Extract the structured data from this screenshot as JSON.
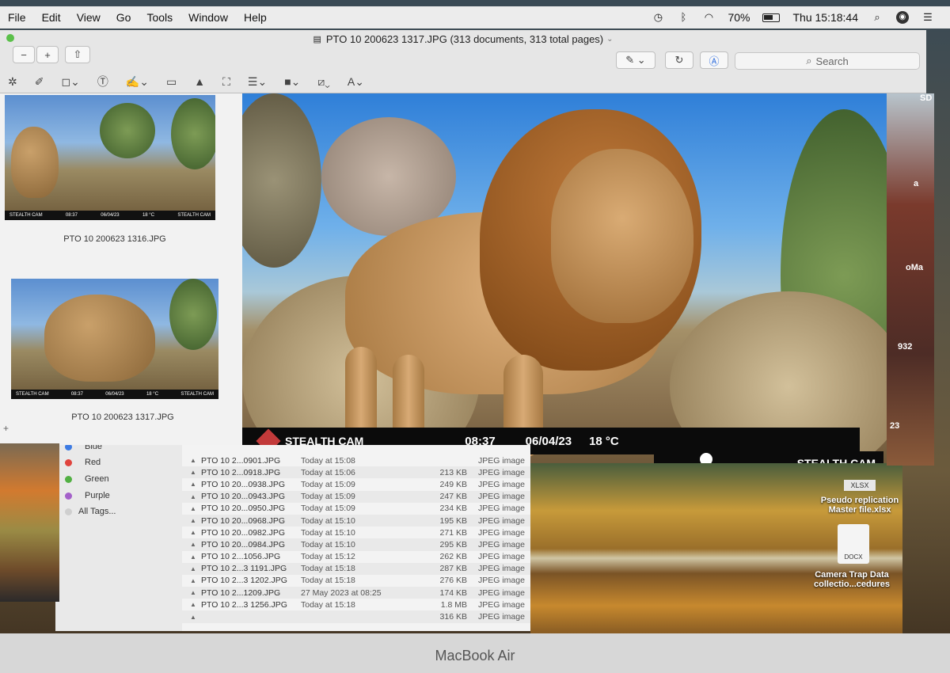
{
  "menubar": {
    "items": [
      "File",
      "Edit",
      "View",
      "Go",
      "Tools",
      "Window",
      "Help"
    ],
    "battery": "70%",
    "clock": "Thu 15:18:44"
  },
  "window": {
    "title": "PTO 10 200623 1317.JPG (313 documents, 313 total pages)",
    "search_placeholder": "Search"
  },
  "sidebar": {
    "thumbs": [
      {
        "caption": "PTO 10 200623 1316.JPG",
        "brand": "STEALTH CAM",
        "time": "08:37",
        "date": "06/04/23",
        "temp": "18 °C"
      },
      {
        "caption": "PTO 10 200623 1317.JPG",
        "brand": "STEALTH CAM",
        "time": "08:37",
        "date": "06/04/23",
        "temp": "18 °C"
      }
    ]
  },
  "photo": {
    "brand": "STEALTH CAM",
    "time": "08:37",
    "date": "06/04/23",
    "temp": "18 °C",
    "brand_right": "STEALTH CAM"
  },
  "finder": {
    "tags": [
      {
        "label": "Blue",
        "color": "#3d7be3"
      },
      {
        "label": "Red",
        "color": "#e0443e"
      },
      {
        "label": "Green",
        "color": "#52b043"
      },
      {
        "label": "Purple",
        "color": "#a461c9"
      },
      {
        "label": "All Tags...",
        "color": "#cfcfcf"
      }
    ],
    "rows": [
      {
        "name": "PTO 10 2...0901.JPG",
        "date": "Today at 15:08",
        "size": "",
        "kind": "JPEG image"
      },
      {
        "name": "PTO 10 2...0918.JPG",
        "date": "Today at 15:06",
        "size": "213 KB",
        "kind": "JPEG image"
      },
      {
        "name": "PTO 10 20...0938.JPG",
        "date": "Today at 15:09",
        "size": "249 KB",
        "kind": "JPEG image"
      },
      {
        "name": "PTO 10 20...0943.JPG",
        "date": "Today at 15:09",
        "size": "247 KB",
        "kind": "JPEG image"
      },
      {
        "name": "PTO 10 20...0950.JPG",
        "date": "Today at 15:09",
        "size": "234 KB",
        "kind": "JPEG image"
      },
      {
        "name": "PTO 10 20...0968.JPG",
        "date": "Today at 15:10",
        "size": "195 KB",
        "kind": "JPEG image"
      },
      {
        "name": "PTO 10 20...0982.JPG",
        "date": "Today at 15:10",
        "size": "271 KB",
        "kind": "JPEG image"
      },
      {
        "name": "PTO 10 20...0984.JPG",
        "date": "Today at 15:10",
        "size": "295 KB",
        "kind": "JPEG image"
      },
      {
        "name": "PTO 10 2...1056.JPG",
        "date": "Today at 15:12",
        "size": "262 KB",
        "kind": "JPEG image"
      },
      {
        "name": "PTO 10 2...3 1191.JPG",
        "date": "Today at 15:18",
        "size": "287 KB",
        "kind": "JPEG image"
      },
      {
        "name": "PTO 10 2...3 1202.JPG",
        "date": "Today at 15:18",
        "size": "276 KB",
        "kind": "JPEG image"
      },
      {
        "name": "PTO 10 2...1209.JPG",
        "date": "27 May 2023 at 08:25",
        "size": "174 KB",
        "kind": "JPEG image"
      },
      {
        "name": "PTO 10 2...3 1256.JPG",
        "date": "Today at 15:18",
        "size": "1.8 MB",
        "kind": "JPEG image"
      },
      {
        "name": "",
        "date": "",
        "size": "316 KB",
        "kind": "JPEG image"
      }
    ]
  },
  "desktop": {
    "xlsx_badge": "XLSX",
    "file1": "Pseudo replication Master file.xlsx",
    "docx_badge": "DOCX",
    "file2": "Camera Trap Data collectio...cedures",
    "peek": [
      "SD",
      "a",
      "oMa",
      "932",
      "23"
    ]
  },
  "bezel": {
    "label": "MacBook Air"
  }
}
